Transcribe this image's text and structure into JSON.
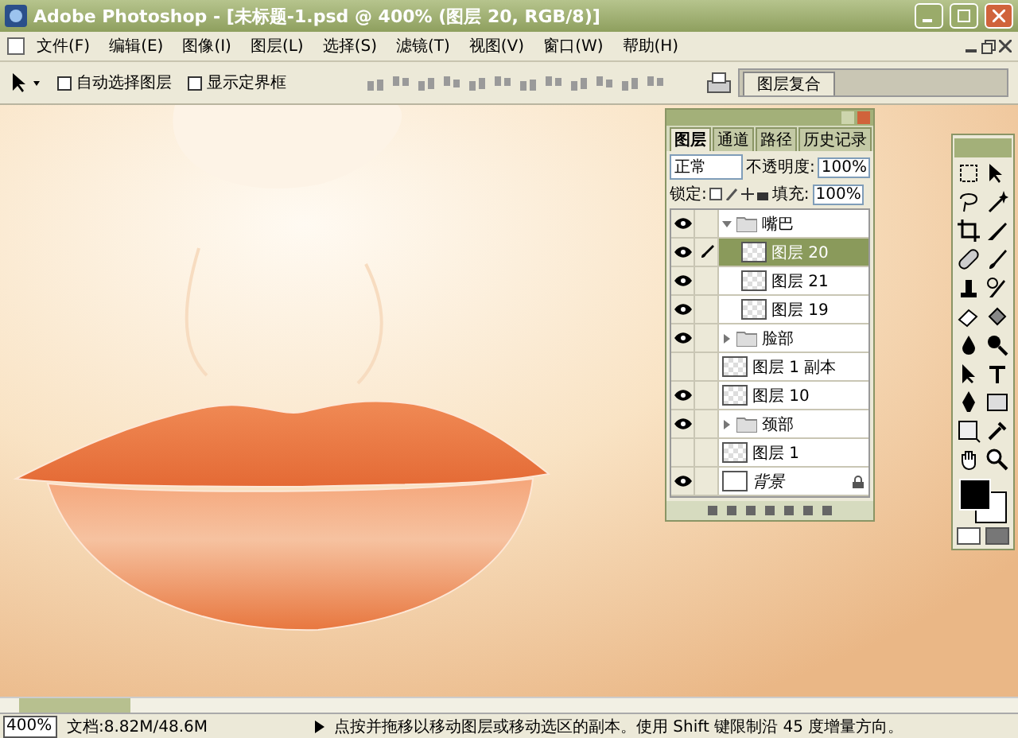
{
  "window": {
    "title": "Adobe Photoshop - [未标题-1.psd @ 400% (图层 20, RGB/8)]"
  },
  "menu": [
    "文件(F)",
    "编辑(E)",
    "图像(I)",
    "图层(L)",
    "选择(S)",
    "滤镜(T)",
    "视图(V)",
    "窗口(W)",
    "帮助(H)"
  ],
  "options_bar": {
    "checkboxes": [
      {
        "label": "自动选择图层",
        "checked": false
      },
      {
        "label": "显示定界框",
        "checked": false
      }
    ],
    "palette_tab": "图层复合"
  },
  "layers_panel": {
    "tabs": [
      {
        "label": "图层",
        "selected": true
      },
      {
        "label": "通道",
        "selected": false
      },
      {
        "label": "路径",
        "selected": false
      },
      {
        "label": "历史记录",
        "selected": false
      }
    ],
    "blend_mode": "正常",
    "opacity_label": "不透明度:",
    "opacity": "100%",
    "lock_label": "锁定:",
    "fill_label": "填充:",
    "fill": "100%",
    "layers": [
      {
        "name": "嘴巴",
        "kind": "group",
        "visible": true,
        "expanded": true,
        "selected": false,
        "children": [
          {
            "name": "图层 20",
            "kind": "layer",
            "visible": true,
            "selected": true
          },
          {
            "name": "图层 21",
            "kind": "layer",
            "visible": true,
            "selected": false
          },
          {
            "name": "图层 19",
            "kind": "layer",
            "visible": true,
            "selected": false
          }
        ]
      },
      {
        "name": "脸部",
        "kind": "group",
        "visible": true,
        "expanded": false,
        "selected": false
      },
      {
        "name": "图层 1 副本",
        "kind": "layer",
        "visible": false,
        "selected": false
      },
      {
        "name": "图层 10",
        "kind": "layer",
        "visible": true,
        "selected": false
      },
      {
        "name": "颈部",
        "kind": "group",
        "visible": true,
        "expanded": false,
        "selected": false
      },
      {
        "name": "图层 1",
        "kind": "layer",
        "visible": false,
        "selected": false
      },
      {
        "name": "背景",
        "kind": "background",
        "visible": true,
        "selected": false
      }
    ]
  },
  "status_bar": {
    "zoom": "400%",
    "doc_info": "文档:8.82M/48.6M",
    "hint": "点按并拖移以移动图层或移动选区的副本。使用 Shift 键限制沿 45 度增量方向。"
  }
}
